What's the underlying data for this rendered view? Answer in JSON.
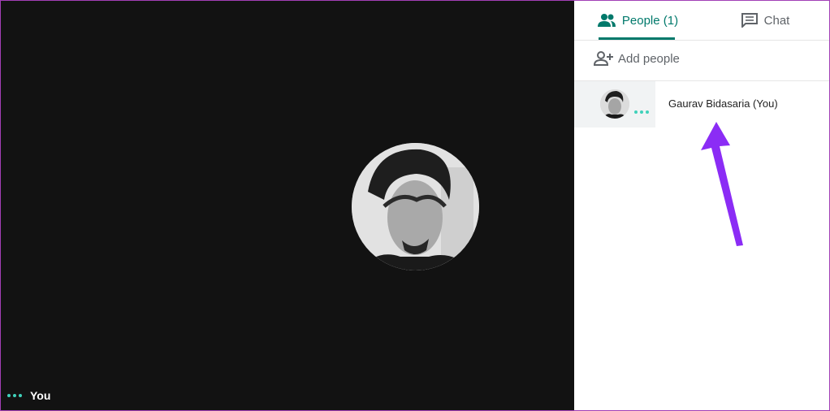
{
  "tabs": [
    {
      "label": "People (1)",
      "icon": "people-icon",
      "active": true
    },
    {
      "label": "Chat",
      "icon": "chat-icon",
      "active": false
    }
  ],
  "add_people": {
    "label": "Add people",
    "icon": "add-person-icon"
  },
  "participants": [
    {
      "name": "Gaurav Bidasaria (You)"
    }
  ],
  "self_label": "You",
  "colors": {
    "accent": "#00796b",
    "video_bg": "#121212",
    "indicator": "#3fd1ba",
    "annotation_arrow": "#8b2cf5"
  }
}
